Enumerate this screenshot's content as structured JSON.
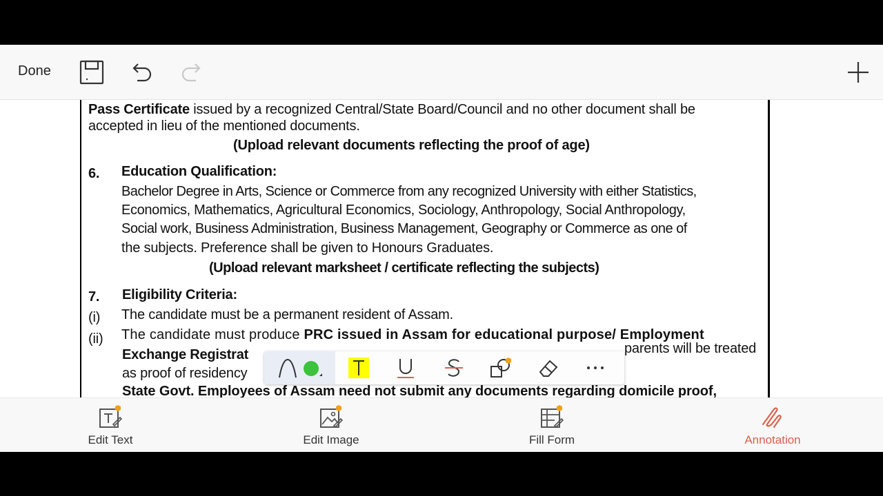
{
  "toolbar": {
    "done_label": "Done",
    "icons": [
      "save-icon",
      "undo-icon",
      "redo-icon",
      "add-icon"
    ]
  },
  "document": {
    "lines": [
      {
        "bold": "Pass Certificate",
        "text": " issued by a recognized Central/State Board/Council and no other document shall be"
      },
      {
        "text": "accepted in lieu of the mentioned documents."
      },
      {
        "text": "(Upload relevant documents reflecting the proof of age)"
      },
      {
        "num": "6.",
        "text": "Education Qualification:"
      },
      {
        "text": "Bachelor Degree in Arts, Science or Commerce from any recognized University with either Statistics,"
      },
      {
        "text": "Economics, Mathematics, Agricultural Economics, Sociology, Anthropology, Social Anthropology,"
      },
      {
        "text": "Social work, Business Administration, Business Management, Geography or Commerce as one of"
      },
      {
        "text": "the subjects. Preference shall be given to Honours Graduates."
      },
      {
        "text": "(Upload relevant marksheet / certificate reflecting the subjects)"
      },
      {
        "num": "7.",
        "text": "Eligibility Criteria:"
      },
      {
        "num": "(i)",
        "text": "The candidate must be a permanent resident of Assam."
      },
      {
        "num": "(ii)",
        "text": "The candidate must produce ",
        "bold": "PRC issued in Assam for educational purpose/ Employment"
      },
      {
        "bold": "Exchange Registrat",
        "text": "parents will be treated"
      },
      {
        "text": "as proof of residency"
      },
      {
        "bold": "State Govt. Employees of Assam need not submit any documents regarding domicile proof,"
      }
    ]
  },
  "annotation_toolbar": {
    "tools": [
      "pen-icon",
      "highlight-text-icon",
      "underline-icon",
      "strikethrough-icon",
      "shapes-icon",
      "eraser-icon",
      "more-icon"
    ],
    "pen_color": "#3cc23c",
    "highlight_color": "#ffff00",
    "premium_badge_color": "#f2a01a"
  },
  "bottom_nav": {
    "items": [
      {
        "label": "Edit Text",
        "icon": "edit-text-icon"
      },
      {
        "label": "Edit Image",
        "icon": "edit-image-icon"
      },
      {
        "label": "Fill Form",
        "icon": "fill-form-icon"
      },
      {
        "label": "Annotation",
        "icon": "annotation-icon",
        "active": true
      }
    ],
    "active_color": "#d9614c"
  }
}
